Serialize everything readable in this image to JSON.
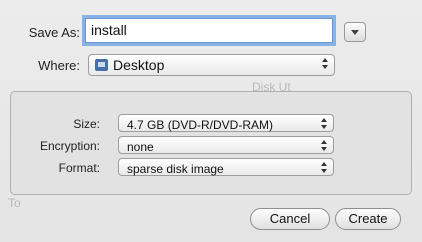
{
  "dialog": {
    "save_as_label": "Save As:",
    "save_as_value": "install",
    "where_label": "Where:",
    "where_value": "Desktop",
    "size_label": "Size:",
    "size_value": "4.7 GB (DVD-R/DVD-RAM)",
    "encryption_label": "Encryption:",
    "encryption_value": "none",
    "format_label": "Format:",
    "format_value": "sparse disk image",
    "cancel_label": "Cancel",
    "create_label": "Create"
  },
  "background": {
    "text_1": "Disk Ut",
    "text_2": "To"
  },
  "icons": {
    "disclosure": "chevron-down-icon",
    "folder": "desktop-folder-icon"
  },
  "colors": {
    "focus_ring": "#88b1e6",
    "dialog_bg": "#e8e8e8"
  }
}
